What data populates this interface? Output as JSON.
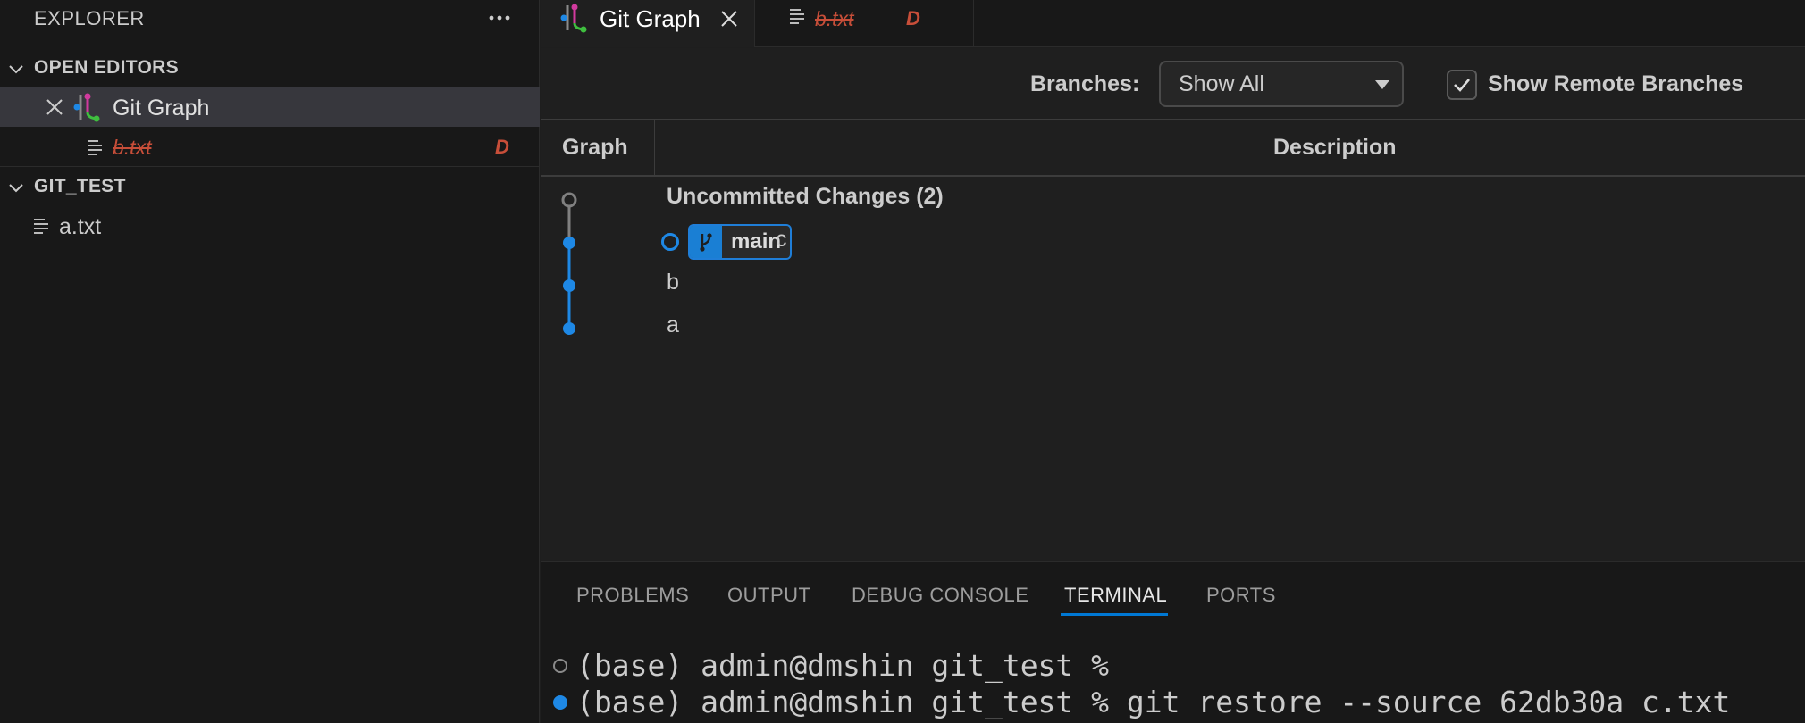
{
  "sidebar": {
    "title": "EXPLORER",
    "open_editors": {
      "header": "OPEN EDITORS",
      "items": [
        {
          "label": "Git Graph"
        },
        {
          "label": "b.txt",
          "badge": "D"
        }
      ]
    },
    "workspace": {
      "header": "GIT_TEST",
      "files": [
        {
          "label": "a.txt"
        }
      ]
    }
  },
  "tabs": [
    {
      "label": "Git Graph",
      "active": true
    },
    {
      "label": "b.txt",
      "badge": "D",
      "deleted": true
    }
  ],
  "git_graph": {
    "branches_label": "Branches:",
    "branch_select_value": "Show All",
    "show_remote_label": "Show Remote Branches",
    "show_remote_checked": true,
    "columns": {
      "graph": "Graph",
      "description": "Description"
    },
    "commits": [
      {
        "message": "Uncommitted Changes (2)",
        "uncommitted": true
      },
      {
        "message": "c",
        "branch": "main",
        "head": true
      },
      {
        "message": "b"
      },
      {
        "message": "a"
      }
    ],
    "colors": {
      "branch": "#1e88e5",
      "uncommitted": "#808080"
    }
  },
  "panel": {
    "tabs": [
      "PROBLEMS",
      "OUTPUT",
      "DEBUG CONSOLE",
      "TERMINAL",
      "PORTS"
    ],
    "active_tab": "TERMINAL",
    "terminal_lines": [
      "(base) admin@dmshin git_test %",
      "(base) admin@dmshin git_test % git restore --source 62db30a c.txt"
    ]
  }
}
